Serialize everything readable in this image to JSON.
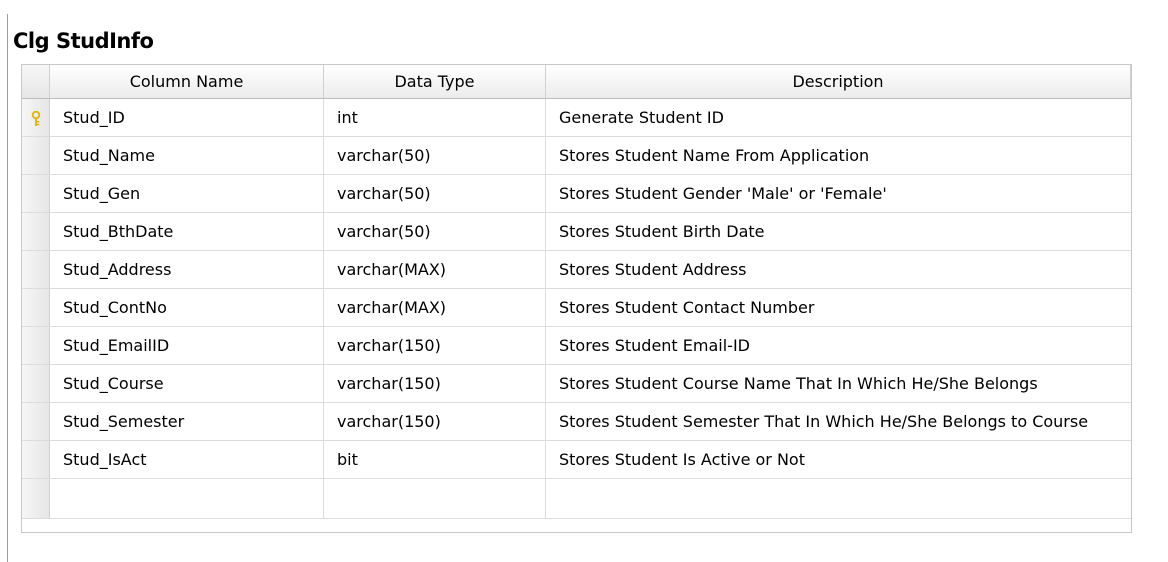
{
  "table": {
    "title": "Clg StudInfo",
    "columns": [
      "Column Name",
      "Data Type",
      "Description"
    ],
    "rows": [
      {
        "name": "Stud_ID",
        "type": "int",
        "description": "Generate Student ID",
        "primary_key": true
      },
      {
        "name": "Stud_Name",
        "type": "varchar(50)",
        "description": "Stores Student Name From Application",
        "primary_key": false
      },
      {
        "name": "Stud_Gen",
        "type": "varchar(50)",
        "description": "Stores Student Gender 'Male' or 'Female'",
        "primary_key": false
      },
      {
        "name": "Stud_BthDate",
        "type": "varchar(50)",
        "description": "Stores Student Birth Date",
        "primary_key": false
      },
      {
        "name": "Stud_Address",
        "type": "varchar(MAX)",
        "description": "Stores Student Address",
        "primary_key": false
      },
      {
        "name": "Stud_ContNo",
        "type": "varchar(MAX)",
        "description": "Stores Student Contact Number",
        "primary_key": false
      },
      {
        "name": "Stud_EmailID",
        "type": "varchar(150)",
        "description": "Stores Student Email-ID",
        "primary_key": false
      },
      {
        "name": "Stud_Course",
        "type": "varchar(150)",
        "description": "Stores Student Course Name That In Which He/She Belongs",
        "primary_key": false
      },
      {
        "name": "Stud_Semester",
        "type": "varchar(150)",
        "description": "Stores Student Semester That In Which He/She Belongs to Course",
        "primary_key": false
      },
      {
        "name": "Stud_IsAct",
        "type": "bit",
        "description": "Stores Student Is Active or Not",
        "primary_key": false
      }
    ]
  },
  "icons": {
    "primary_key": "key-icon"
  },
  "colors": {
    "key_icon": "#e0b400",
    "grid_line": "#dcdcdc"
  }
}
